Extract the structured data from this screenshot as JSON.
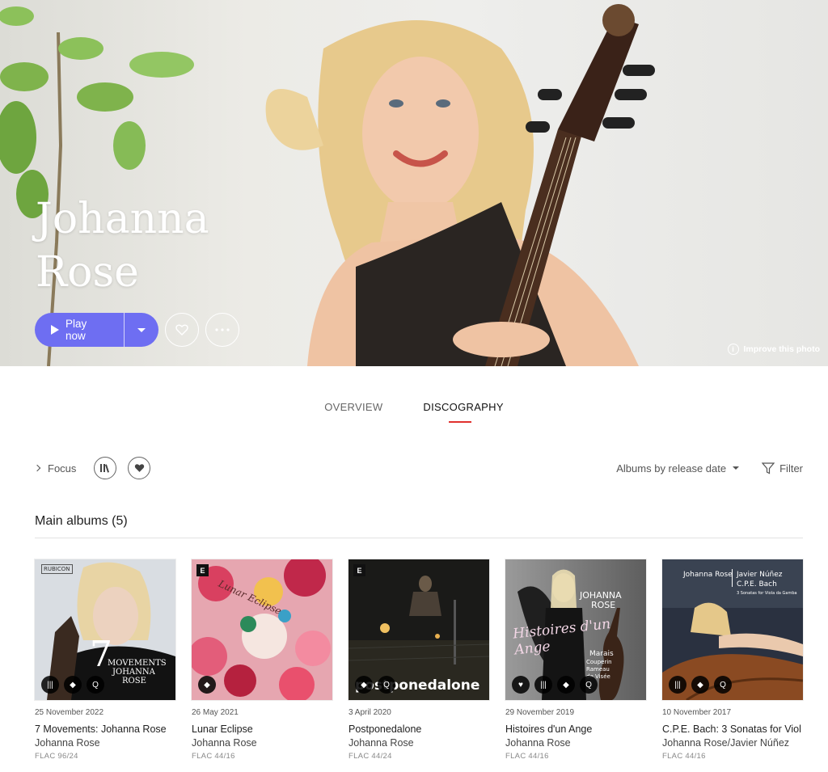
{
  "artist": {
    "name_line1": "Johanna",
    "name_line2": "Rose"
  },
  "actions": {
    "play_label": "Play now"
  },
  "improve_photo_label": "Improve this photo",
  "tabs": [
    {
      "label": "OVERVIEW",
      "active": false
    },
    {
      "label": "DISCOGRAPHY",
      "active": true
    }
  ],
  "toolbar": {
    "focus_label": "Focus",
    "sort_label": "Albums by release date",
    "filter_label": "Filter"
  },
  "section": {
    "title": "Main albums (5)"
  },
  "colors": {
    "accent": "#6e6ef2",
    "tab_underline": "#e0312f"
  },
  "albums": [
    {
      "date": "25 November 2022",
      "title": "7 Movements: Johanna Rose",
      "artist": "Johanna Rose",
      "format": "FLAC 96/24",
      "explicit": false,
      "cover_label": "RUBICON",
      "cover_number": "7",
      "cover_text1": "MOVEMENTS",
      "cover_text2": "JOHANNA",
      "cover_text3": "ROSE",
      "icons": [
        "library-icon",
        "tidal-icon",
        "qobuz-icon"
      ]
    },
    {
      "date": "26 May 2021",
      "title": "Lunar Eclipse",
      "artist": "Johanna Rose",
      "format": "FLAC 44/16",
      "explicit": true,
      "cover_text1": "Lunar Eclipse",
      "icons": [
        "tidal-icon"
      ]
    },
    {
      "date": "3 April 2020",
      "title": "Postponedalone",
      "artist": "Johanna Rose",
      "format": "FLAC 44/24",
      "explicit": true,
      "cover_text1": "postponedalone",
      "icons": [
        "tidal-icon",
        "qobuz-icon"
      ]
    },
    {
      "date": "29 November 2019",
      "title": "Histoires d'un Ange",
      "artist": "Johanna Rose",
      "format": "FLAC 44/16",
      "explicit": false,
      "cover_text1": "JOHANNA",
      "cover_text2": "ROSE",
      "cover_text3": "Histoires d'un Ange",
      "cover_text4": "Marais",
      "cover_text5": "Couperin",
      "cover_text6": "Rameau",
      "cover_text7": "de Visée",
      "icons": [
        "heart-icon",
        "library-icon",
        "tidal-icon",
        "qobuz-icon"
      ]
    },
    {
      "date": "10 November 2017",
      "title": "C.P.E. Bach: 3 Sonatas for Viol",
      "artist": "Johanna Rose/Javier Núñez",
      "format": "FLAC 44/16",
      "explicit": false,
      "cover_text1": "Johanna Rose",
      "cover_text2": "Javier Núñez",
      "cover_text3": "C.P.E. Bach",
      "cover_text4": "3 Sonatas for Viola da Gamba",
      "icons": [
        "library-icon",
        "tidal-icon",
        "qobuz-icon"
      ]
    }
  ]
}
